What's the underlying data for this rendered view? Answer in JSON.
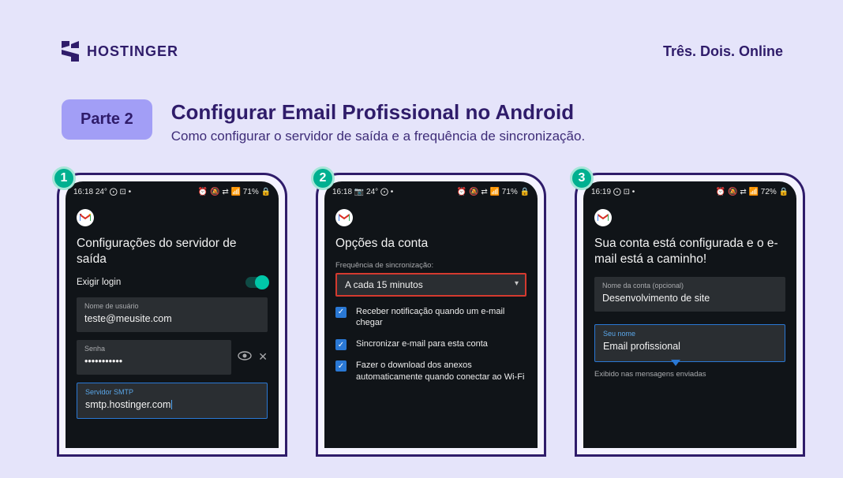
{
  "brand": {
    "name": "HOSTINGER",
    "tagline": "Três. Dois. Online"
  },
  "badge": "Parte 2",
  "title": "Configurar Email Profissional no Android",
  "subtitle": "Como configurar o servidor de saída e a frequência de sincronização.",
  "steps": {
    "n1": "1",
    "n2": "2",
    "n3": "3"
  },
  "status": {
    "s1_time": "16:18",
    "s1_extra": "24° ⨀ ⊡ •",
    "s1_right": "⏰ 🔕 ⇄ 📶 71% 🔒",
    "s2_time": "16:18",
    "s2_extra": "📷 24° ⨀ •",
    "s2_right": "⏰ 🔕 ⇄ 📶 71% 🔒",
    "s3_time": "16:19",
    "s3_extra": "⨀ ⊡ •",
    "s3_right": "⏰ 🔕 ⇄ 📶 72% 🔒"
  },
  "screen1": {
    "title": "Configurações do servidor de saída",
    "require_login_label": "Exigir login",
    "user_label": "Nome de usuário",
    "user_value": "teste@meusite.com",
    "pw_label": "Senha",
    "pw_value": "•••••••••••",
    "smtp_label": "Servidor SMTP",
    "smtp_value": "smtp.hostinger.com"
  },
  "screen2": {
    "title": "Opções da conta",
    "freq_label": "Frequência de sincronização:",
    "freq_value": "A cada 15 minutos",
    "opt1": "Receber notificação quando um e-mail chegar",
    "opt2": "Sincronizar e-mail para esta conta",
    "opt3": "Fazer o download dos anexos automaticamente quando conectar ao Wi-Fi"
  },
  "screen3": {
    "title": "Sua conta está configurada e o e-mail está a caminho!",
    "acct_label": "Nome da conta (opcional)",
    "acct_value": "Desenvolvimento de site",
    "name_label": "Seu nome",
    "name_value": "Email profissional",
    "name_hint": "Exibido nas mensagens enviadas"
  }
}
